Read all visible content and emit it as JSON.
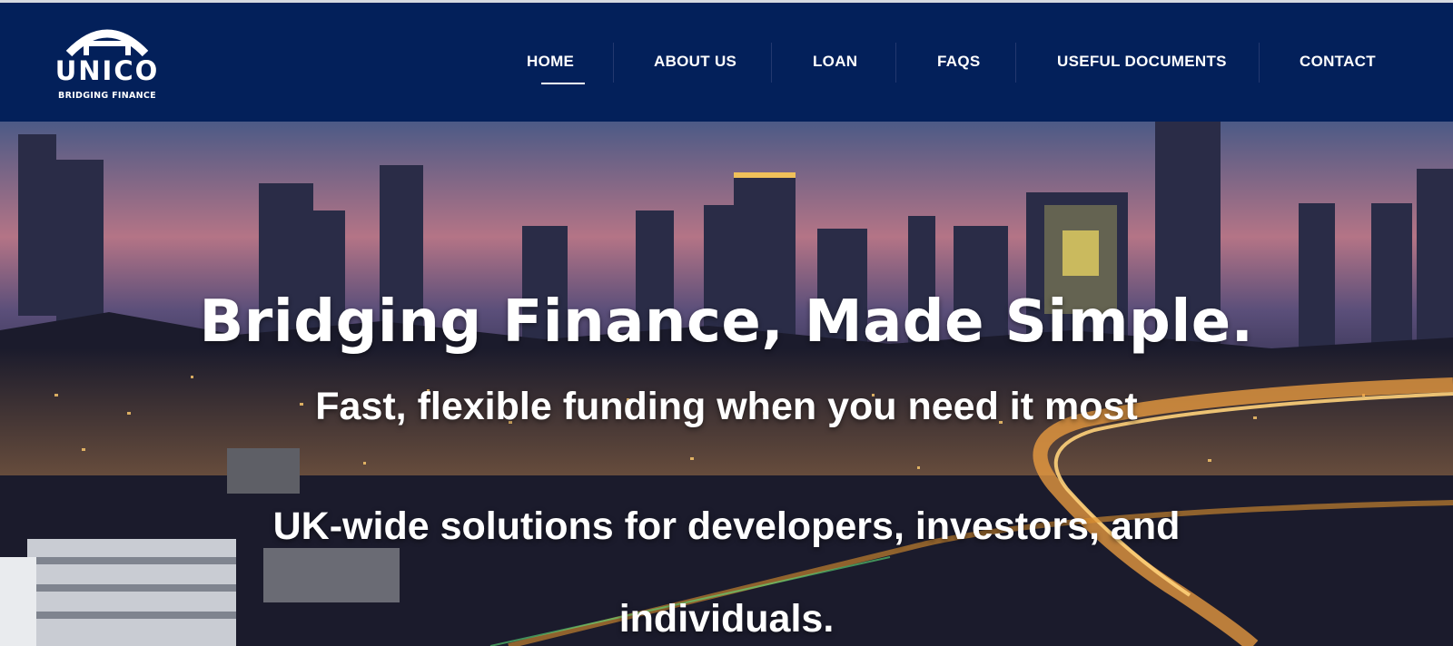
{
  "brand": {
    "name": "UNICO",
    "tagline": "BRIDGING FINANCE",
    "color": "#03205a"
  },
  "nav": {
    "items": [
      {
        "label": "HOME",
        "active": true
      },
      {
        "label": "ABOUT US"
      },
      {
        "label": "LOAN"
      },
      {
        "label": "FAQS"
      },
      {
        "label": "USEFUL DOCUMENTS"
      },
      {
        "label": "CONTACT"
      }
    ]
  },
  "hero": {
    "title": "Bridging Finance, Made Simple.",
    "subtitle": "Fast, flexible funding when you need it most",
    "description": "UK-wide solutions for developers, investors, and individuals."
  }
}
